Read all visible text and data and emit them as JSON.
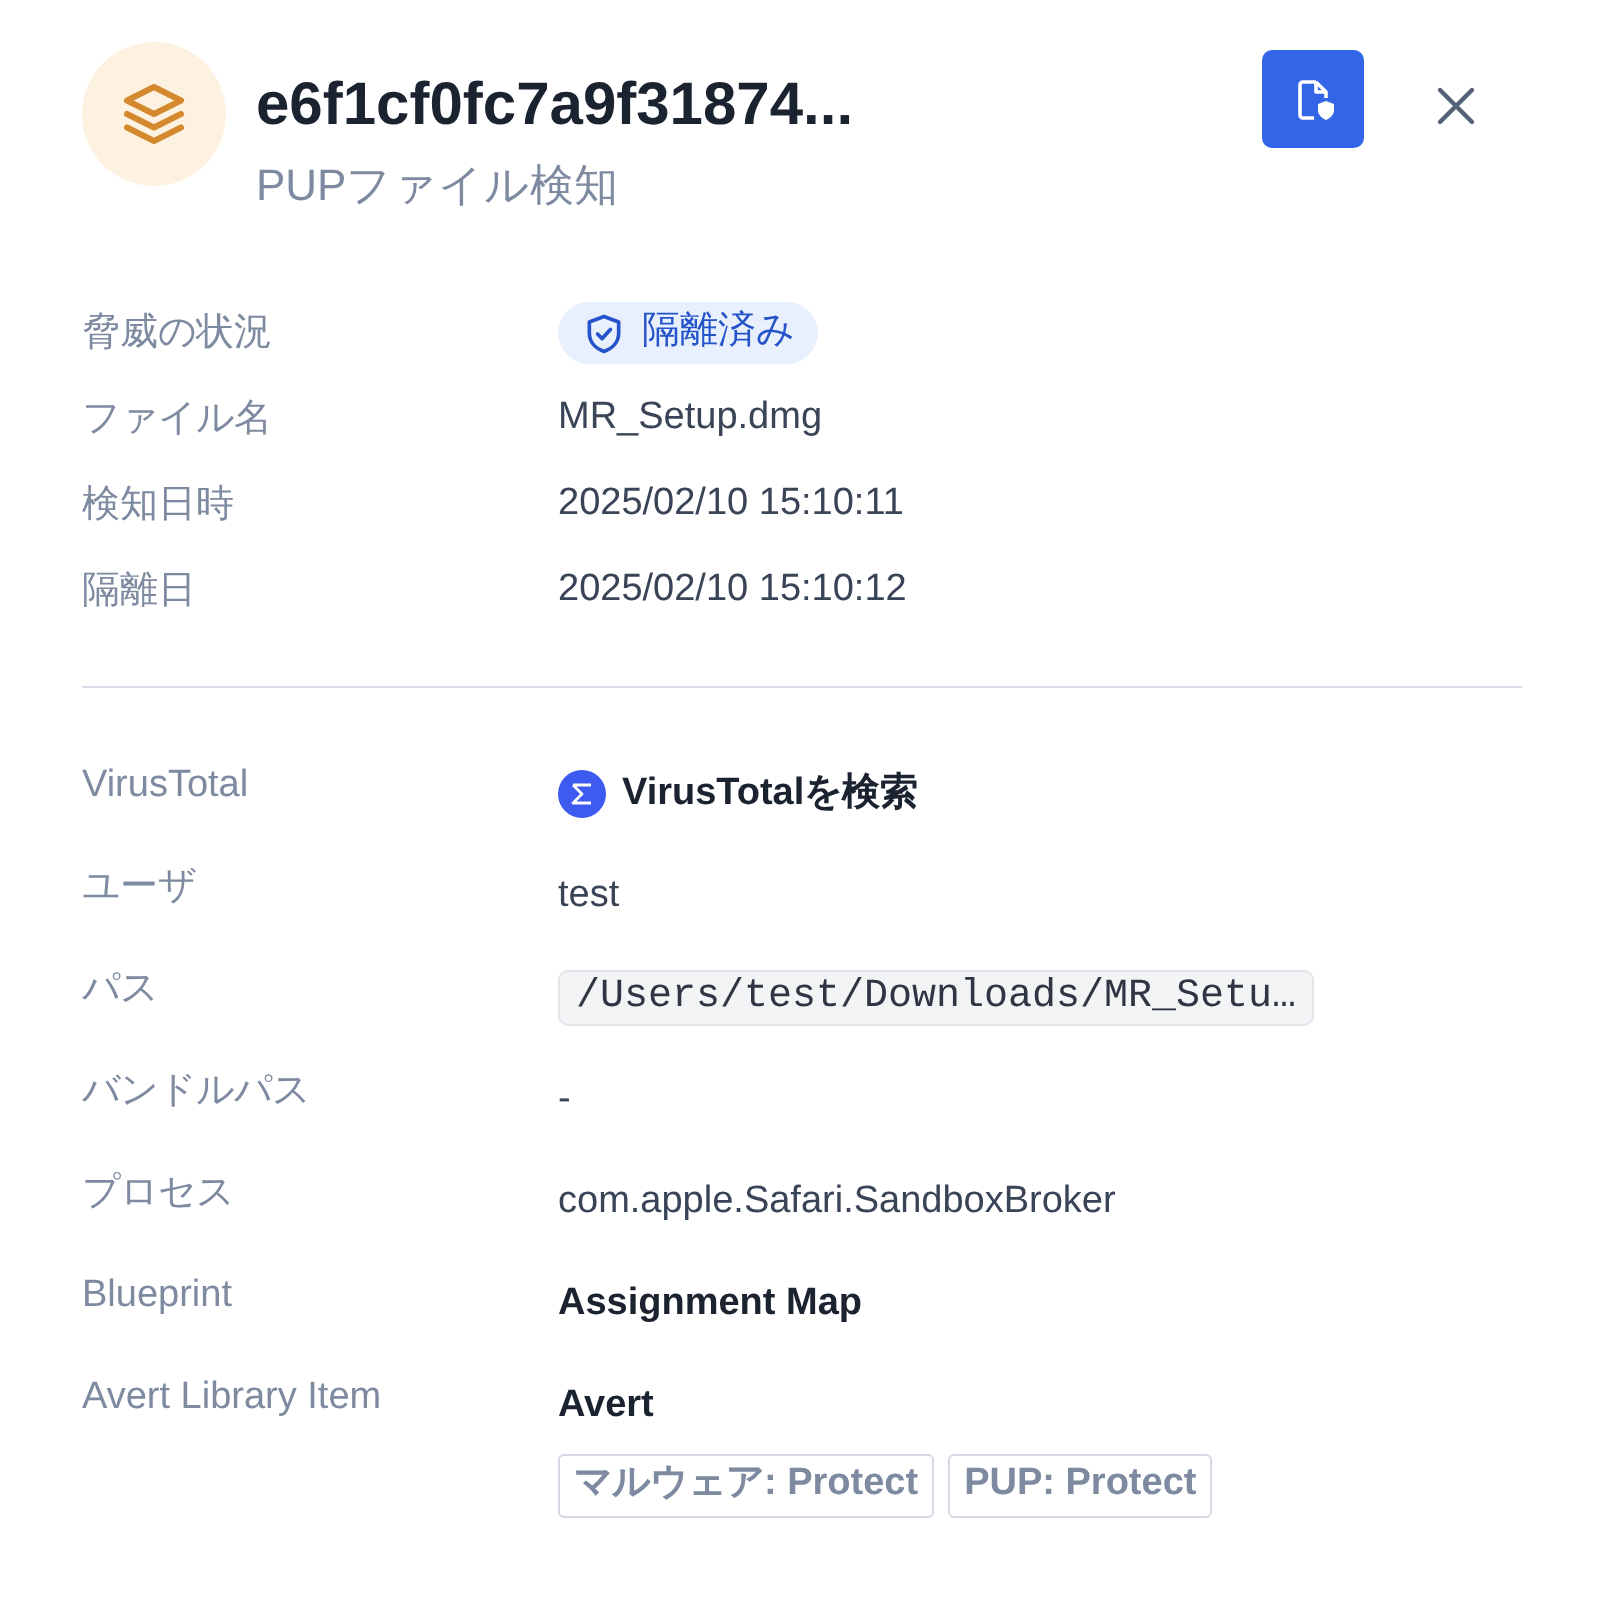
{
  "header": {
    "title": "e6f1cf0fc7a9f31874...",
    "subtitle": "PUPファイル検知"
  },
  "sections": [
    {
      "rows": [
        {
          "label": "脅威の状況",
          "kind": "status",
          "value": "隔離済み"
        },
        {
          "label": "ファイル名",
          "kind": "text",
          "value": "MR_Setup.dmg"
        },
        {
          "label": "検知日時",
          "kind": "text",
          "value": "2025/02/10 15:10:11"
        },
        {
          "label": "隔離日",
          "kind": "text",
          "value": "2025/02/10 15:10:12"
        }
      ]
    },
    {
      "rows": [
        {
          "label": "VirusTotal",
          "kind": "link",
          "value": "VirusTotalを検索"
        },
        {
          "label": "ユーザ",
          "kind": "text",
          "value": "test"
        },
        {
          "label": "パス",
          "kind": "code",
          "value": "/Users/test/Downloads/MR_Setu…"
        },
        {
          "label": "バンドルパス",
          "kind": "text",
          "value": "-"
        },
        {
          "label": "プロセス",
          "kind": "text",
          "value": "com.apple.Safari.SandboxBroker"
        },
        {
          "label": "Blueprint",
          "kind": "strong",
          "value": "Assignment Map"
        },
        {
          "label": "Avert Library Item",
          "kind": "strong",
          "value": "Avert",
          "tags": [
            "マルウェア: Protect",
            "PUP: Protect"
          ]
        }
      ]
    }
  ]
}
